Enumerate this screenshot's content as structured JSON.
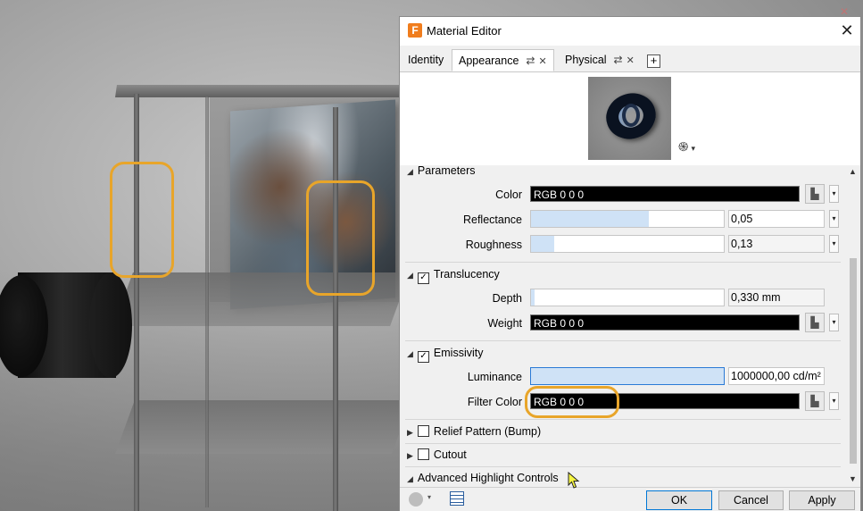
{
  "window": {
    "title": "Material Editor",
    "app_icon_letter": "F",
    "close_glyph": "✕"
  },
  "tabs": [
    {
      "label": "Identity",
      "active": false
    },
    {
      "label": "Appearance",
      "active": true,
      "link_icon": "⇄",
      "close_icon": "✕"
    },
    {
      "label": "Physical",
      "active": false,
      "link_icon": "⇄",
      "close_icon": "✕"
    }
  ],
  "add_tab_glyph": "+",
  "preview": {
    "render_settings_glyph": "֍",
    "render_settings_caret": "▾"
  },
  "sections": {
    "parameters": {
      "title": "Parameters",
      "color": {
        "label": "Color",
        "value": "RGB 0 0 0"
      },
      "reflectance": {
        "label": "Reflectance",
        "value": "0,05",
        "fraction": 0.61
      },
      "roughness": {
        "label": "Roughness",
        "value": "0,13",
        "fraction": 0.12
      }
    },
    "translucency": {
      "title": "Translucency",
      "checked": true,
      "depth": {
        "label": "Depth",
        "value": "0,330 mm",
        "fraction": 0.02
      },
      "weight": {
        "label": "Weight",
        "value": "RGB 0 0 0"
      }
    },
    "emissivity": {
      "title": "Emissivity",
      "checked": true,
      "luminance": {
        "label": "Luminance",
        "value": "1000000,00 cd/m²",
        "fraction": 1.0
      },
      "filter_color": {
        "label": "Filter Color",
        "value": "RGB 0 0 0"
      }
    },
    "relief": {
      "title": "Relief Pattern (Bump)",
      "checked": false
    },
    "cutout": {
      "title": "Cutout",
      "checked": false
    },
    "advanced": {
      "title": "Advanced Highlight Controls"
    }
  },
  "glyphs": {
    "expanded": "◢",
    "collapsed": "▶",
    "dropdown": "▾",
    "checkmark": "✓",
    "picker": "▙",
    "scroll_up": "▲",
    "scroll_down": "▼"
  },
  "buttons": {
    "ok": "OK",
    "cancel": "Cancel",
    "apply": "Apply"
  },
  "colors": {
    "accent_highlight": "#e8a52a",
    "slider_fill": "#cfe2f6",
    "brand": "#f07d1d"
  }
}
